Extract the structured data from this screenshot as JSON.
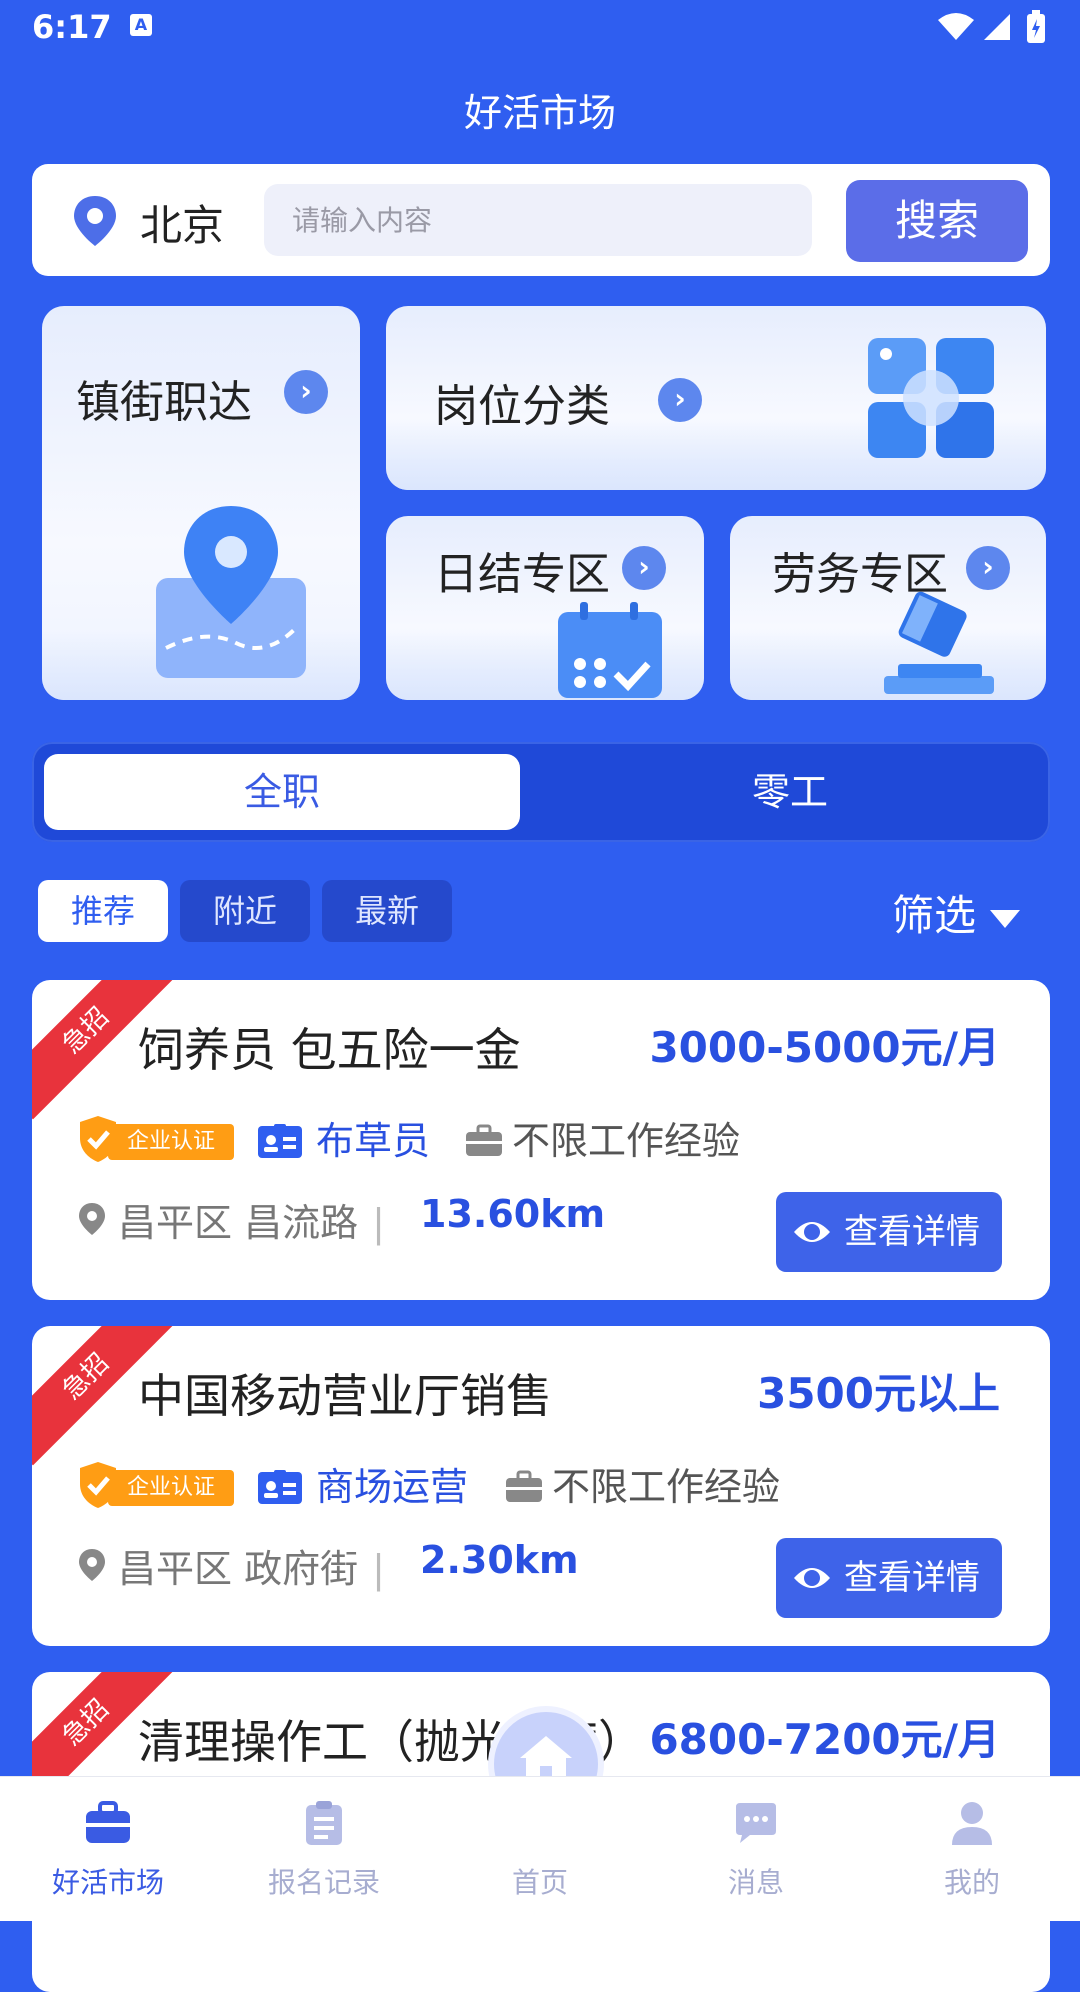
{
  "status_bar": {
    "time": "6:17",
    "notification_icon": "A"
  },
  "header": {
    "title": "好活市场"
  },
  "search": {
    "city": "北京",
    "placeholder": "请输入内容",
    "button_label": "搜索"
  },
  "categories": [
    {
      "label": "镇街职达",
      "icon": "map-pin-icon"
    },
    {
      "label": "岗位分类",
      "icon": "grid-icon"
    },
    {
      "label": "日结专区",
      "icon": "calendar-icon"
    },
    {
      "label": "劳务专区",
      "icon": "gavel-icon"
    }
  ],
  "job_type_toggle": {
    "selected": "全职",
    "other": "零工"
  },
  "filter_chips": [
    {
      "label": "推荐",
      "active": true
    },
    {
      "label": "附近",
      "active": false
    },
    {
      "label": "最新",
      "active": false
    }
  ],
  "filter_button": "筛选",
  "jobs": [
    {
      "badge": "急招",
      "title": "饲养员 包五险一金",
      "salary": "3000-5000元/月",
      "cert": "企业认证",
      "type": "布草员",
      "experience": "不限工作经验",
      "address": "昌平区 昌流路",
      "distance": "13.60km",
      "detail_label": "查看详情"
    },
    {
      "badge": "急招",
      "title": "中国移动营业厅销售",
      "salary": "3500元以上",
      "cert": "企业认证",
      "type": "商场运营",
      "experience": "不限工作经验",
      "address": "昌平区 政府街",
      "distance": "2.30km",
      "detail_label": "查看详情"
    },
    {
      "badge": "急招",
      "title": "清理操作工（抛光打磨）",
      "salary": "6800-7200元/月"
    }
  ],
  "tab_bar": [
    {
      "label": "好活市场",
      "icon": "briefcase-icon",
      "active": true
    },
    {
      "label": "报名记录",
      "icon": "clipboard-icon",
      "active": false
    },
    {
      "label": "首页",
      "icon": "home-icon",
      "active": false
    },
    {
      "label": "消息",
      "icon": "chat-icon",
      "active": false
    },
    {
      "label": "我的",
      "icon": "user-icon",
      "active": false
    }
  ],
  "colors": {
    "primary": "#2f5ef0",
    "accent_button": "#3e63e9",
    "urgent": "#e8333c",
    "cert": "#ff9d14",
    "salary_text": "#2950e0"
  }
}
